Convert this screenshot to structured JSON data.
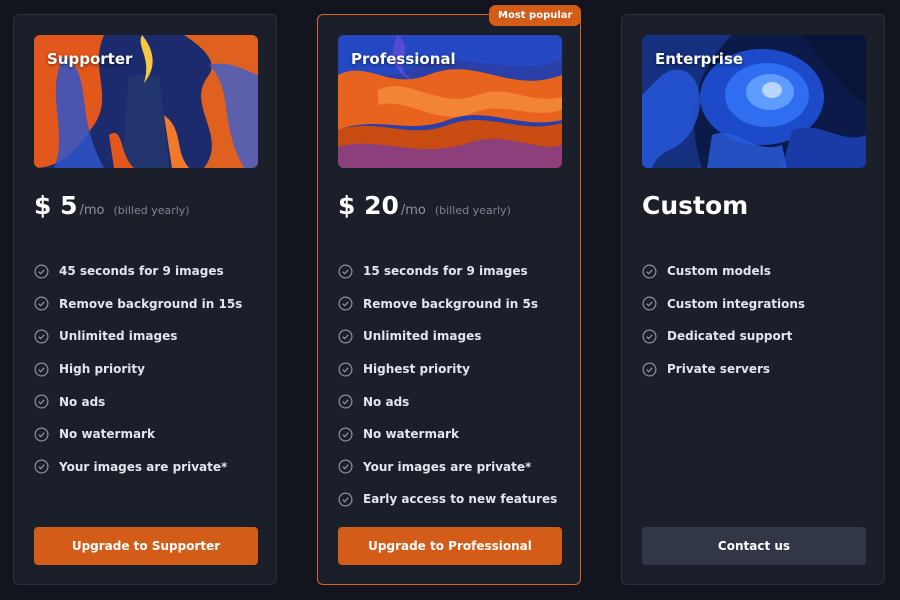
{
  "accent_color": "#d35d18",
  "plans": [
    {
      "name": "Supporter",
      "price": "$ 5",
      "period": "/mo",
      "billing_note": "(billed yearly)",
      "features": [
        "45 seconds for 9 images",
        "Remove background in 15s",
        "Unlimited images",
        "High priority",
        "No ads",
        "No watermark",
        "Your images are private*"
      ],
      "cta_label": "Upgrade to Supporter"
    },
    {
      "name": "Professional",
      "badge": "Most popular",
      "price": "$ 20",
      "period": "/mo",
      "billing_note": "(billed yearly)",
      "features": [
        "15 seconds for 9 images",
        "Remove background in 5s",
        "Unlimited images",
        "Highest priority",
        "No ads",
        "No watermark",
        "Your images are private*",
        "Early access to new features"
      ],
      "cta_label": "Upgrade to Professional"
    },
    {
      "name": "Enterprise",
      "price": "Custom",
      "features": [
        "Custom models",
        "Custom integrations",
        "Dedicated support",
        "Private servers"
      ],
      "cta_label": "Contact us"
    }
  ]
}
